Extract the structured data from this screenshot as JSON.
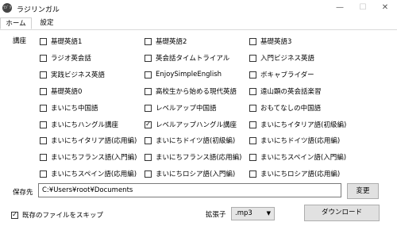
{
  "window": {
    "app_icon_text": "ﾗｼﾞﾘﾝｶﾞﾙ",
    "title": "ラジリンガル",
    "minimize": "—",
    "maximize": "☐",
    "close": "✕"
  },
  "tabs": [
    {
      "label": "ホーム",
      "active": true
    },
    {
      "label": "設定",
      "active": false
    }
  ],
  "lessons_label": "講座",
  "lessons": [
    {
      "label": "基礎英語1",
      "checked": false
    },
    {
      "label": "基礎英語2",
      "checked": false
    },
    {
      "label": "基礎英語3",
      "checked": false
    },
    {
      "label": "ラジオ英会話",
      "checked": false
    },
    {
      "label": "英会話タイムトライアル",
      "checked": false
    },
    {
      "label": "入門ビジネス英語",
      "checked": false
    },
    {
      "label": "実践ビジネス英語",
      "checked": false
    },
    {
      "label": "EnjoySimpleEnglish",
      "checked": false
    },
    {
      "label": "ボキャブライダー",
      "checked": false
    },
    {
      "label": "基礎英語0",
      "checked": false
    },
    {
      "label": "高校生から始める現代英語",
      "checked": false
    },
    {
      "label": "遠山顕の英会話楽習",
      "checked": false
    },
    {
      "label": "まいにち中国語",
      "checked": false
    },
    {
      "label": "レベルアップ中国語",
      "checked": false
    },
    {
      "label": "おもてなしの中国語",
      "checked": false
    },
    {
      "label": "まいにちハングル講座",
      "checked": false
    },
    {
      "label": "レベルアップハングル講座",
      "checked": true
    },
    {
      "label": "まいにちイタリア語(初級編)",
      "checked": false
    },
    {
      "label": "まいにちイタリア語(応用編)",
      "checked": false
    },
    {
      "label": "まいにちドイツ語(初級編)",
      "checked": false
    },
    {
      "label": "まいにちドイツ語(応用編)",
      "checked": false
    },
    {
      "label": "まいにちフランス語(入門編)",
      "checked": false
    },
    {
      "label": "まいにちフランス語(応用編)",
      "checked": false
    },
    {
      "label": "まいにちスペイン語(入門編)",
      "checked": false
    },
    {
      "label": "まいにちスペイン語(応用編)",
      "checked": false
    },
    {
      "label": "まいにちロシア語(入門編)",
      "checked": false
    },
    {
      "label": "まいにちロシア語(応用編)",
      "checked": false
    }
  ],
  "save": {
    "label": "保存先",
    "path": "C:¥Users¥root¥Documents",
    "browse_label": "変更"
  },
  "skip_existing": {
    "label": "既存のファイルをスキップ",
    "checked": true
  },
  "extension": {
    "label": "拡張子",
    "value": ".mp3"
  },
  "download_label": "ダウンロード"
}
